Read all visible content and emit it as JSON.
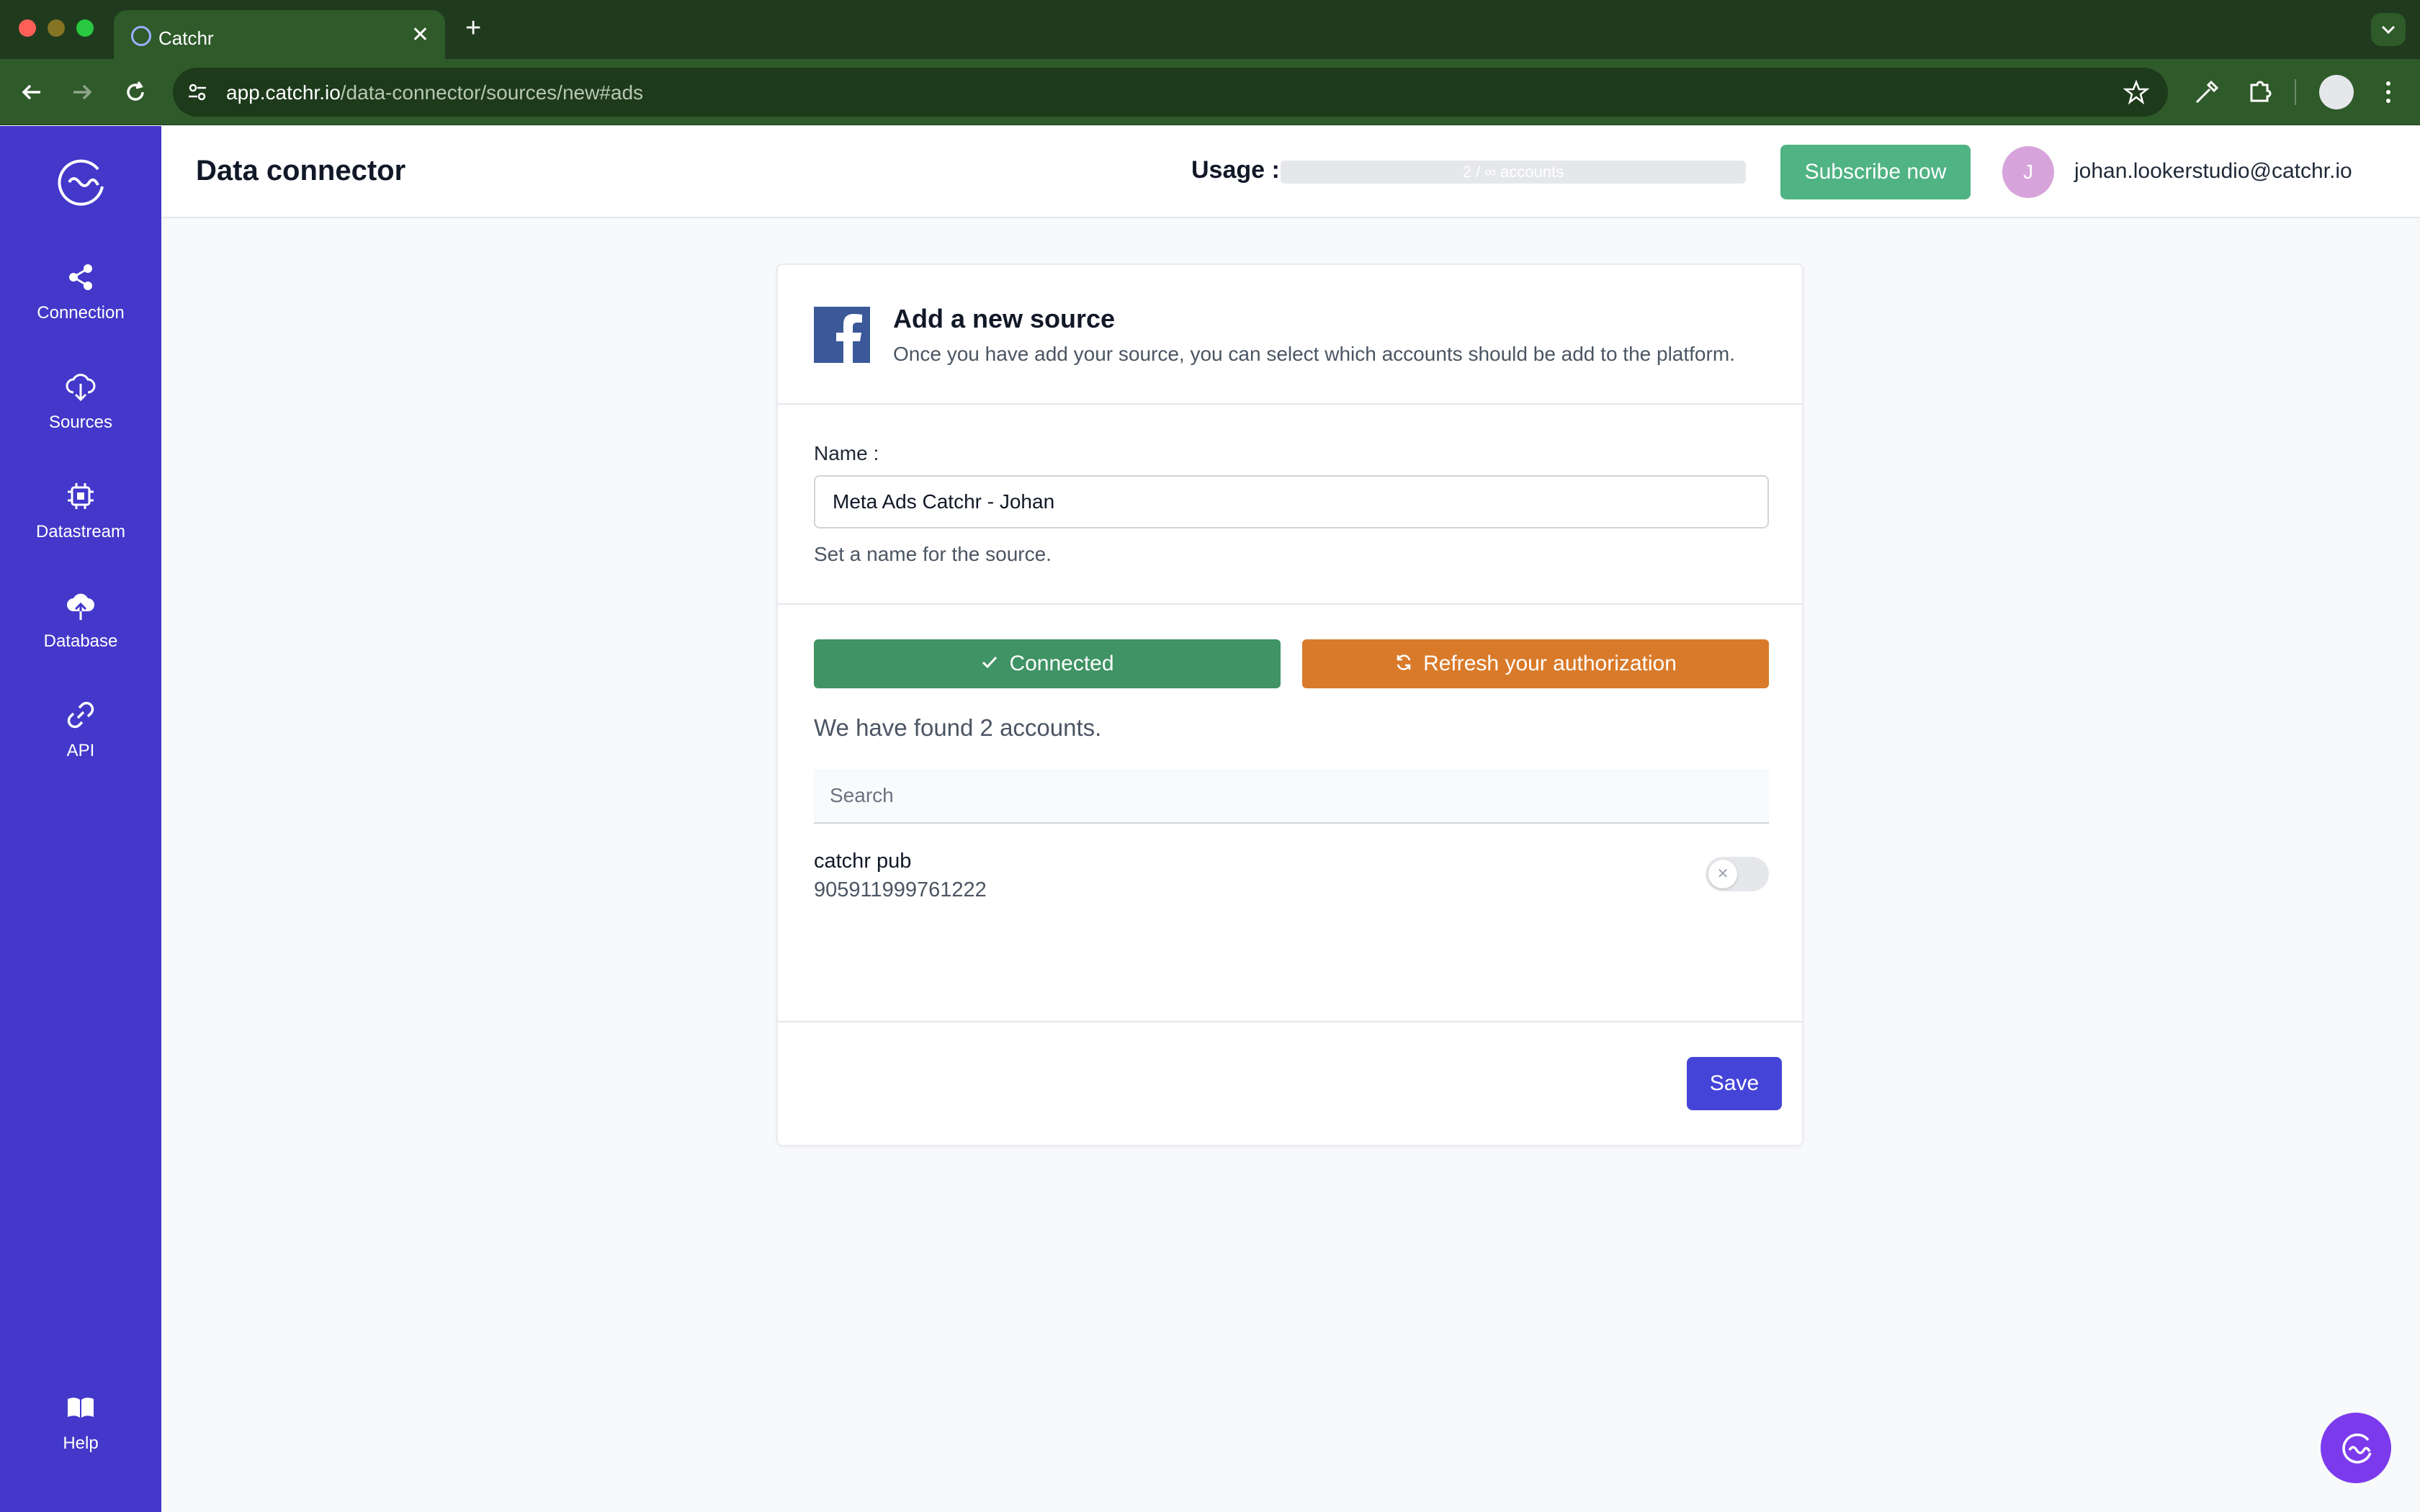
{
  "browser": {
    "tab_title": "Catchr",
    "tab_close": "✕",
    "new_tab": "+",
    "url_host": "app.catchr.io",
    "url_path": "/data-connector/sources/new#ads"
  },
  "sidebar": {
    "items": [
      {
        "label": "Connection",
        "icon": "share-icon"
      },
      {
        "label": "Sources",
        "icon": "cloud-download-icon"
      },
      {
        "label": "Datastream",
        "icon": "chip-icon"
      },
      {
        "label": "Database",
        "icon": "cloud-upload-icon"
      },
      {
        "label": "API",
        "icon": "link-icon"
      }
    ],
    "help_label": "Help"
  },
  "header": {
    "title": "Data connector",
    "usage_label": "Usage :",
    "usage_value": "2 / ∞ accounts",
    "subscribe_label": "Subscribe now",
    "avatar_initial": "J",
    "user_email": "johan.lookerstudio@catchr.io"
  },
  "card": {
    "title": "Add a new source",
    "subtitle": "Once you have add your source, you can select which accounts should be add to the platform.",
    "name_label": "Name :",
    "name_value": "Meta Ads Catchr - Johan",
    "name_help": "Set a name for the source.",
    "connected_label": "Connected",
    "refresh_label": "Refresh your authorization",
    "found_text": "We have found 2 accounts.",
    "search_placeholder": "Search",
    "accounts": [
      {
        "name": "catchr pub",
        "id": "905911999761222",
        "enabled": false
      }
    ],
    "save_label": "Save"
  },
  "colors": {
    "sidebar": "#4338ca",
    "browser_chrome": "#2f5a2a",
    "subscribe": "#4fb383",
    "connected": "#3f9364",
    "refresh": "#d97a2a",
    "save": "#4444d8",
    "facebook": "#3b5998",
    "chat": "#7c3aed"
  }
}
